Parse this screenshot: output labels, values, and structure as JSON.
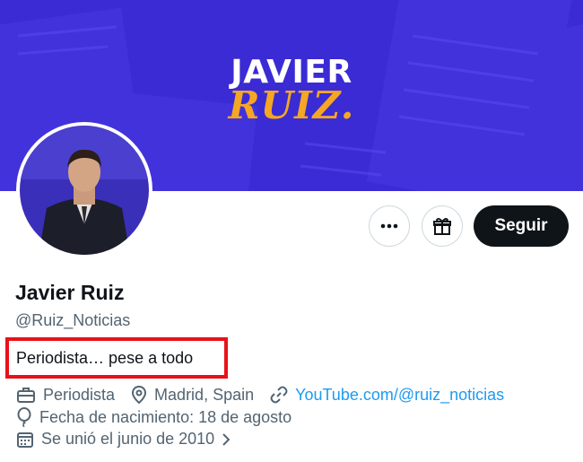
{
  "banner": {
    "title": "JAVIER",
    "subtitle": "RUIZ.",
    "background_color": "#3b2bd4",
    "accent_color": "#f5a623"
  },
  "profile": {
    "name": "Javier Ruiz",
    "handle": "@Ruiz_Noticias",
    "bio": "Periodista… pese a todo",
    "highlight_color": "#e8111a"
  },
  "actions": {
    "more_icon": "more-icon",
    "gift_icon": "gift-icon",
    "follow_label": "Seguir"
  },
  "meta": {
    "profession": "Periodista",
    "location": "Madrid, Spain",
    "website": "YouTube.com/@ruiz_noticias",
    "birthday": "Fecha de nacimiento: 18 de agosto",
    "joined": "Se unió el junio de 2010"
  }
}
